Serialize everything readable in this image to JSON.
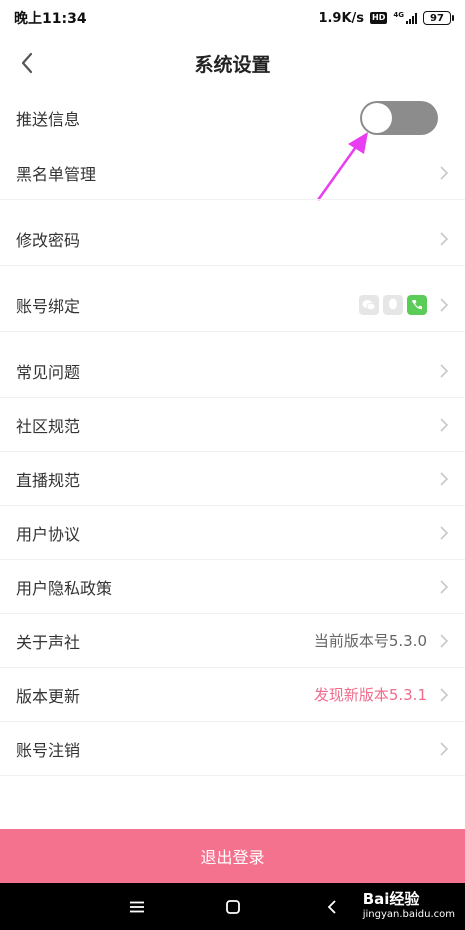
{
  "status_bar": {
    "time": "晚上11:34",
    "speed": "1.9K/s",
    "hd": "HD",
    "network": "4G",
    "battery": "97"
  },
  "header": {
    "title": "系统设置"
  },
  "settings": {
    "push": {
      "label": "推送信息",
      "enabled": false
    },
    "blacklist": {
      "label": "黑名单管理"
    },
    "password": {
      "label": "修改密码"
    },
    "account_bind": {
      "label": "账号绑定"
    },
    "faq": {
      "label": "常见问题"
    },
    "community": {
      "label": "社区规范"
    },
    "live": {
      "label": "直播规范"
    },
    "agreement": {
      "label": "用户协议"
    },
    "privacy": {
      "label": "用户隐私政策"
    },
    "about": {
      "label": "关于声社",
      "value": "当前版本号5.3.0"
    },
    "update": {
      "label": "版本更新",
      "value": "发现新版本5.3.1"
    },
    "cancel": {
      "label": "账号注销"
    }
  },
  "logout_label": "退出登录",
  "watermark": {
    "brand": "Bai经验",
    "url": "jingyan.baidu.com"
  },
  "colors": {
    "accent_pink": "#f5728f",
    "pink_text": "#f16b8c",
    "toggle_off": "#8c8c8c",
    "arrow_magenta": "#e83df0",
    "phone_green": "#5ccc59"
  }
}
